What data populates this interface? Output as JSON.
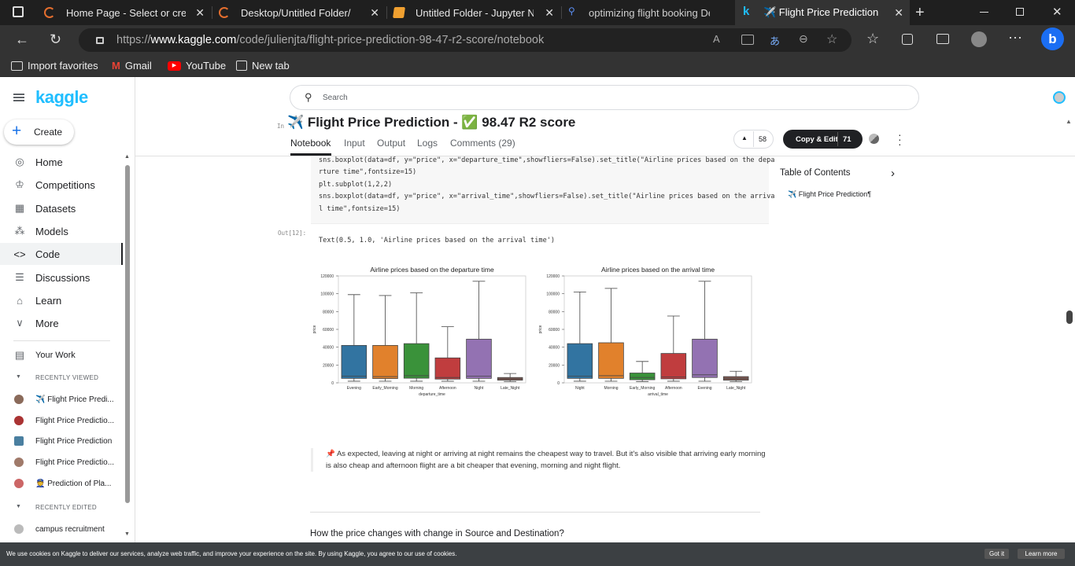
{
  "browser": {
    "tabs": [
      {
        "title": "Home Page - Select or create",
        "icon": "jupyter-icon"
      },
      {
        "title": "Desktop/Untitled Folder/",
        "icon": "jupyter-icon"
      },
      {
        "title": "Untitled Folder - Jupyter Note",
        "icon": "notebook-icon"
      },
      {
        "title": "optimizing flight booking Dec",
        "icon": "search-icon"
      },
      {
        "title": "✈️ Flight Price Prediction - ✅",
        "icon": "kaggle-icon"
      }
    ],
    "url_prefix": "https://",
    "url_domain": "www.kaggle.com",
    "url_path": "/code/julienjta/flight-price-prediction-98-47-r2-score/notebook",
    "favorites": [
      "Import favorites",
      "Gmail",
      "YouTube",
      "New tab"
    ]
  },
  "kaggle": {
    "brand": "kaggle",
    "create_label": "Create",
    "nav": [
      "Home",
      "Competitions",
      "Datasets",
      "Models",
      "Code",
      "Discussions",
      "Learn",
      "More"
    ],
    "your_work": "Your Work",
    "recently_viewed_header": "RECENTLY VIEWED",
    "recently_viewed": [
      "✈️ Flight Price Predi...",
      "Flight Price Predictio...",
      "Flight Price Prediction",
      "Flight Price Predictio...",
      "👮 Prediction of Pla..."
    ],
    "recently_edited_header": "RECENTLY EDITED",
    "recently_edited": [
      "campus recruitment"
    ],
    "search_placeholder": "Search"
  },
  "notebook": {
    "title": "✈️ Flight Price Prediction - ✅ 98.47 R2 score",
    "tabs": [
      "Notebook",
      "Input",
      "Output",
      "Logs",
      "Comments (29)"
    ],
    "upvotes": "58",
    "copy_edit_label": "Copy & Edit",
    "copy_count": "71",
    "in_label": "In",
    "out_label": "Out[12]:",
    "code_lines": [
      "sns.boxplot(data=df, y=\"price\", x=\"departure_time\",showfliers=False).set_title(\"Airline prices based on the depa",
      "rture time\",fontsize=15)",
      "plt.subplot(1,2,2)",
      "sns.boxplot(data=df, y=\"price\", x=\"arrival_time\",showfliers=False).set_title(\"Airline prices based on the arriva",
      "l time\",fontsize=15)"
    ],
    "output_text": "Text(0.5, 1.0, 'Airline prices based on the arrival time')",
    "markdown": "📌 As expected, leaving at night or arriving at night remains the cheapest way to travel. But it's also visible that arriving early morning is also cheap and afternoon flight are a bit cheaper that evening, morning and night flight.",
    "next_heading": "How the price changes with change in Source and Destination?",
    "toc_title": "Table of Contents",
    "toc_item": "✈️ Flight Price Prediction¶"
  },
  "cookie": {
    "text": "We use cookies on Kaggle to deliver our services, analyze web traffic, and improve your experience on the site. By using Kaggle, you agree to our use of cookies.",
    "got_it": "Got it",
    "learn_more": "Learn more"
  },
  "chart_data": [
    {
      "type": "box",
      "title": "Airline prices based on the departure time",
      "xlabel": "departure_time",
      "ylabel": "price",
      "ylim": [
        0,
        120000
      ],
      "yticks": [
        0,
        20000,
        40000,
        60000,
        80000,
        100000,
        120000
      ],
      "categories": [
        "Evening",
        "Early_Morning",
        "Morning",
        "Afternoon",
        "Night",
        "Late_Night"
      ],
      "colors": [
        "#3274a1",
        "#e1812c",
        "#3a923a",
        "#c03d3e",
        "#9372b2",
        "#845b53"
      ],
      "boxes": [
        {
          "min": 1800,
          "q1": 5000,
          "median": 7500,
          "q3": 42000,
          "max": 99000
        },
        {
          "min": 1800,
          "q1": 4800,
          "median": 7000,
          "q3": 42000,
          "max": 98000
        },
        {
          "min": 1800,
          "q1": 5200,
          "median": 8000,
          "q3": 44000,
          "max": 101000
        },
        {
          "min": 1800,
          "q1": 4200,
          "median": 6000,
          "q3": 28000,
          "max": 63000
        },
        {
          "min": 1800,
          "q1": 5000,
          "median": 7500,
          "q3": 49000,
          "max": 114000
        },
        {
          "min": 1500,
          "q1": 3000,
          "median": 4500,
          "q3": 6000,
          "max": 10500
        }
      ]
    },
    {
      "type": "box",
      "title": "Airline prices based on the arrival time",
      "xlabel": "arrival_time",
      "ylabel": "price",
      "ylim": [
        0,
        120000
      ],
      "yticks": [
        0,
        20000,
        40000,
        60000,
        80000,
        100000,
        120000
      ],
      "categories": [
        "Night",
        "Morning",
        "Early_Morning",
        "Afternoon",
        "Evening",
        "Late_Night"
      ],
      "colors": [
        "#3274a1",
        "#e1812c",
        "#3a923a",
        "#c03d3e",
        "#9372b2",
        "#845b53"
      ],
      "boxes": [
        {
          "min": 1800,
          "q1": 5000,
          "median": 7500,
          "q3": 44000,
          "max": 102000
        },
        {
          "min": 1800,
          "q1": 5000,
          "median": 8000,
          "q3": 45000,
          "max": 106000
        },
        {
          "min": 1500,
          "q1": 3500,
          "median": 6000,
          "q3": 11000,
          "max": 24000
        },
        {
          "min": 1800,
          "q1": 4500,
          "median": 6500,
          "q3": 33000,
          "max": 75000
        },
        {
          "min": 1800,
          "q1": 6000,
          "median": 9000,
          "q3": 49000,
          "max": 114000
        },
        {
          "min": 1500,
          "q1": 3000,
          "median": 5000,
          "q3": 7000,
          "max": 13000
        }
      ]
    }
  ]
}
